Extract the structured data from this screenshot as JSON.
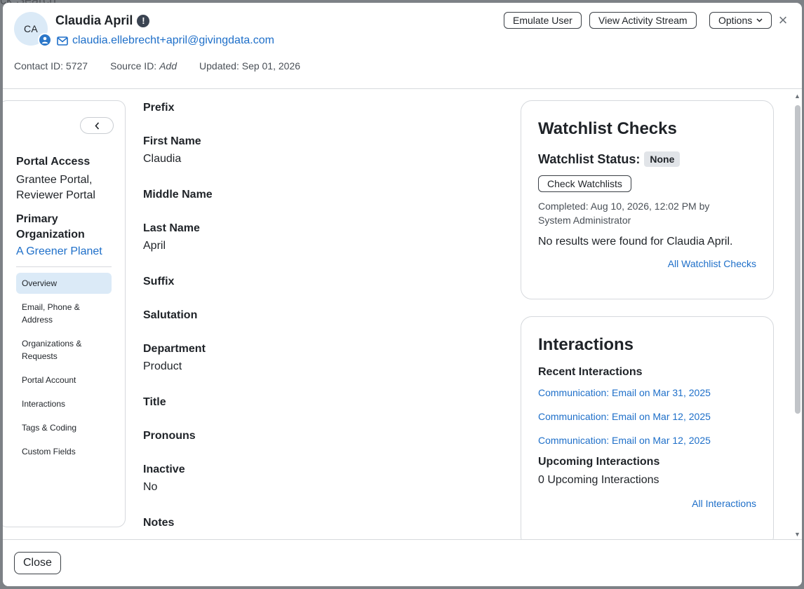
{
  "backdrop": {
    "text": "ck Search"
  },
  "contact": {
    "initials": "CA",
    "name": "Claudia April",
    "email": "claudia.ellebrecht+april@givingdata.com",
    "contact_id": "Contact ID: 5727",
    "source_label": "Source ID:",
    "source_value": "Add",
    "updated": "Updated: Sep 01, 2026"
  },
  "header_buttons": {
    "emulate": "Emulate User",
    "activity": "View Activity Stream",
    "options": "Options"
  },
  "sidebar": {
    "portal_access_label": "Portal Access",
    "portal_access_value_1": "Grantee Portal,",
    "portal_access_value_2": "Reviewer Portal",
    "primary_org_label_1": "Primary",
    "primary_org_label_2": "Organization",
    "primary_org_value": "A Greener Planet",
    "nav": [
      "Overview",
      "Email, Phone & Address",
      "Organizations & Requests",
      "Portal Account",
      "Interactions",
      "Tags & Coding",
      "Custom Fields"
    ]
  },
  "fields": [
    {
      "label": "Prefix",
      "value": ""
    },
    {
      "label": "First Name",
      "value": "Claudia"
    },
    {
      "label": "Middle Name",
      "value": ""
    },
    {
      "label": "Last Name",
      "value": "April"
    },
    {
      "label": "Suffix",
      "value": ""
    },
    {
      "label": "Salutation",
      "value": ""
    },
    {
      "label": "Department",
      "value": "Product"
    },
    {
      "label": "Title",
      "value": ""
    },
    {
      "label": "Pronouns",
      "value": ""
    },
    {
      "label": "Inactive",
      "value": "No"
    },
    {
      "label": "Notes",
      "value": ""
    }
  ],
  "watchlist": {
    "title": "Watchlist Checks",
    "status_label": "Watchlist Status:",
    "status_value": "None",
    "check_button": "Check Watchlists",
    "completed_1": "Completed: Aug 10, 2026, 12:02 PM by",
    "completed_2": "System Administrator",
    "result": "No results were found for Claudia April.",
    "all_link": "All Watchlist Checks"
  },
  "interactions": {
    "title": "Interactions",
    "recent_label": "Recent Interactions",
    "recent": [
      "Communication: Email on Mar 31, 2025",
      "Communication: Email on Mar 12, 2025",
      "Communication: Email on Mar 12, 2025"
    ],
    "upcoming_label": "Upcoming Interactions",
    "upcoming_value": "0 Upcoming Interactions",
    "all_link": "All Interactions"
  },
  "footer": {
    "close": "Close"
  },
  "colors": {
    "link": "#1e6fc9",
    "avatar_bg": "#dbeaf7",
    "active_nav": "#dbeaf7"
  }
}
